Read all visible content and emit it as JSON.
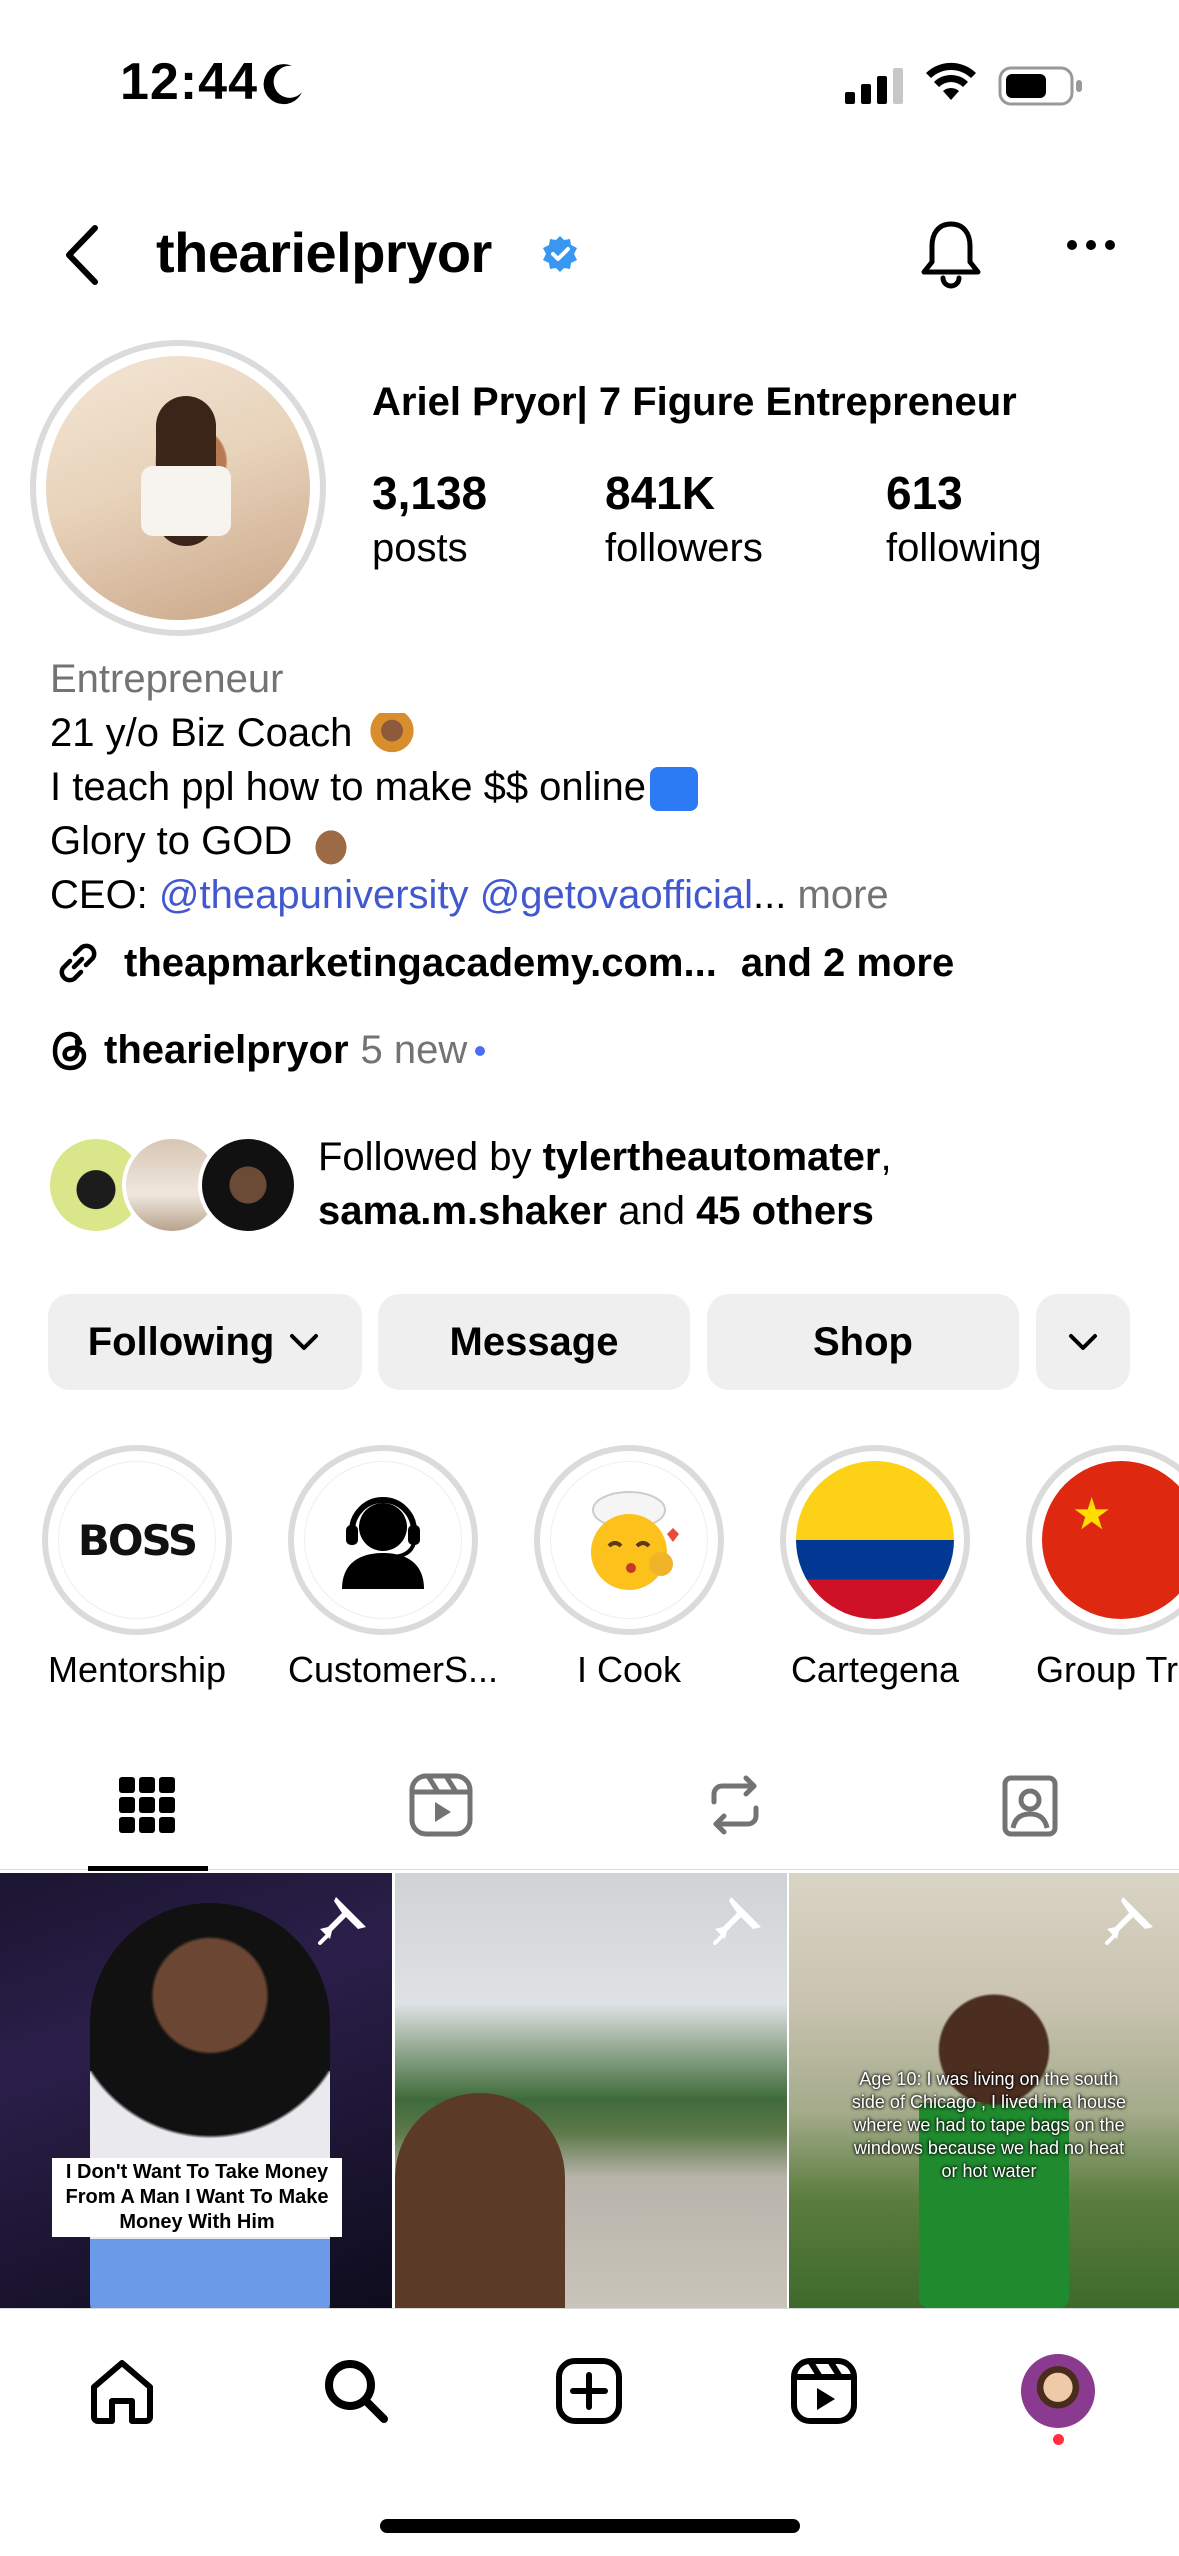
{
  "status_bar": {
    "time": "12:44"
  },
  "header": {
    "username": "thearielpryor"
  },
  "profile": {
    "display_name": "Ariel Pryor| 7 Figure Entrepreneur",
    "stats": [
      {
        "value": "3,138",
        "label": "posts"
      },
      {
        "value": "841K",
        "label": "followers"
      },
      {
        "value": "613",
        "label": "following"
      }
    ],
    "bio": {
      "category": "Entrepreneur",
      "line1": "21 y/o Biz Coach",
      "line2": "I teach ppl how to make $$ online",
      "line3": "Glory to GOD",
      "line4_prefix": "CEO: ",
      "mention1": "@theapuniversity",
      "mention2": "@getovaofficial",
      "ellipsis": "...",
      "more": " more"
    },
    "link": {
      "url": "theapmarketingacademy.com...",
      "more": "and 2 more"
    },
    "threads": {
      "name": "thearielpryor",
      "new": "5 new"
    },
    "followed_by": {
      "prefix": "Followed by ",
      "user1": "tylertheautomater",
      "comma": ",",
      "user2": "sama.m.shaker",
      "and": " and ",
      "others": "45 others"
    }
  },
  "actions": {
    "following": "Following",
    "message": "Message",
    "shop": "Shop"
  },
  "highlights": [
    {
      "label": "Mentorship",
      "text": "BOSS"
    },
    {
      "label": "CustomerS..."
    },
    {
      "label": "I Cook"
    },
    {
      "label": "Cartegena"
    },
    {
      "label": "Group Trip"
    }
  ],
  "posts": [
    {
      "caption": "I Don't Want To Take Money From A Man I Want To Make Money With Him",
      "pinned": true
    },
    {
      "caption": "",
      "pinned": true
    },
    {
      "caption": "Age 10: I was living on the south side of Chicago , I lived in a house where we had to tape bags on the windows because we had no heat or hot water",
      "pinned": true
    }
  ],
  "colors": {
    "link_blue": "#4158d0",
    "muted": "#737373",
    "button_bg": "#efefef",
    "notification_red": "#ff3040",
    "verified_blue": "#3897f0"
  },
  "icons": [
    "back-arrow-icon",
    "verified-badge-icon",
    "bell-icon",
    "more-icon",
    "link-icon",
    "threads-icon",
    "chevron-down-icon",
    "grid-icon",
    "reels-icon",
    "reposts-icon",
    "tagged-icon",
    "pin-icon",
    "home-icon",
    "search-icon",
    "create-icon",
    "reels-nav-icon"
  ]
}
